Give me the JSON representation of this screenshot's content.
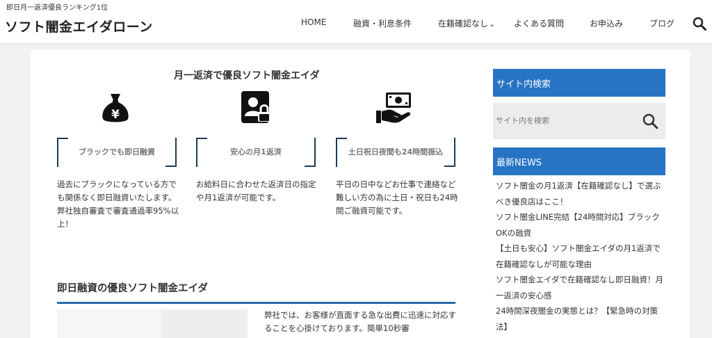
{
  "header": {
    "tagline": "即日月一返済優良ランキング1位",
    "site_title": "ソフト闇金エイダローン",
    "nav": [
      {
        "label": "HOME"
      },
      {
        "label": "融資・利息条件"
      },
      {
        "label": "在籍確認なし",
        "has_dropdown": true
      },
      {
        "label": "よくある質問"
      },
      {
        "label": "お申込み"
      },
      {
        "label": "ブログ"
      }
    ],
    "search_icon": "search-icon"
  },
  "main": {
    "heading": "月一返済で優良ソフト闇金エイダ",
    "features": [
      {
        "icon": "money-bag-yen-icon",
        "title": "ブラックでも即日融資",
        "desc": "過去にブラックになっている方でも関係なく即日融資いたします。弊社独自審査で審査通過率95%以上！"
      },
      {
        "icon": "id-card-lock-icon",
        "title": "安心の月1返済",
        "desc": "お給料日に合わせた返済日の指定や月1返済が可能です。"
      },
      {
        "icon": "hand-money-icon",
        "title": "土日祝日夜間も24時間振込",
        "desc": "平日の日中などお仕事で連絡など難しい方の為に土日・祝日も24時間ご融資可能です。"
      }
    ],
    "section2_title": "即日融資の優良ソフト闇金エイダ",
    "body_text": "弊社では、お客様が直面する急な出費に迅速に対応することを心掛けております。簡単10秒審"
  },
  "sidebar": {
    "search_title": "サイト内検索",
    "search_placeholder": "サイト内を検索",
    "news_title": "最新NEWS",
    "news": [
      "ソフト闇金の月1返済【在籍確認なし】で選ぶべき優良店はここ！",
      "ソフト闇金LINE完結【24時間対応】ブラックOKの融資",
      "【土日も安心】ソフト闇金エイダの月1返済で在籍確認なしが可能な理由",
      "ソフト闇金エイダで在籍確認なし即日融資！月一返済の安心感",
      "24時間深夜闇金の実態とは？【緊急時の対策法】"
    ]
  },
  "colors": {
    "accent": "#2774c4",
    "heading_line": "#2a6aa8",
    "box_border": "#1a3a55"
  }
}
